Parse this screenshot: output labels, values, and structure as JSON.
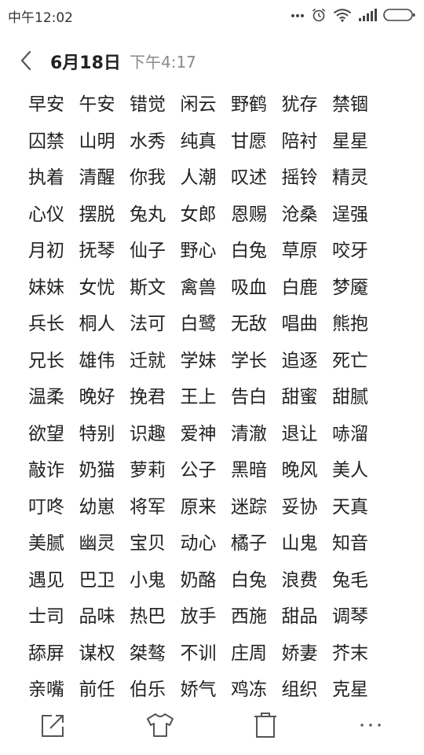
{
  "status_bar": {
    "time": "中午12:02",
    "icons": [
      "more-dots-icon",
      "alarm-clock-icon",
      "wifi-icon",
      "signal-bars-icon",
      "battery-icon"
    ]
  },
  "header": {
    "back_icon": "chevron-left-icon",
    "date": "6月18日",
    "time": "下午4:17"
  },
  "note": {
    "rows": [
      [
        "早安",
        "午安",
        "错觉",
        "闲云",
        "野鹤",
        "犹存",
        "禁锢"
      ],
      [
        "囚禁",
        "山明",
        "水秀",
        "纯真",
        "甘愿",
        "陪衬",
        "星星"
      ],
      [
        "执着",
        "清醒",
        "你我",
        "人潮",
        "叹述",
        "摇铃",
        "精灵"
      ],
      [
        "心仪",
        "摆脱",
        "兔丸",
        "女郎",
        "恩赐",
        "沧桑",
        "逞强"
      ],
      [
        "月初",
        "抚琴",
        "仙子",
        "野心",
        "白兔",
        "草原",
        "咬牙"
      ],
      [
        "妹妹",
        "女忧",
        "斯文",
        "禽兽",
        "吸血",
        "白鹿",
        "梦魇"
      ],
      [
        "兵长",
        "桐人",
        "法可",
        "白鹭",
        "无敌",
        "唱曲",
        "熊抱"
      ],
      [
        "兄长",
        "雄伟",
        "迁就",
        "学妹",
        "学长",
        "追逐",
        "死亡"
      ],
      [
        "温柔",
        "晚好",
        "挽君",
        "王上",
        "告白",
        "甜蜜",
        "甜腻"
      ],
      [
        "欲望",
        "特别",
        "识趣",
        "爱神",
        "清澈",
        "退让",
        "哧溜"
      ],
      [
        "敲诈",
        "奶猫",
        "萝莉",
        "公子",
        "黑暗",
        "晚风",
        "美人"
      ],
      [
        "叮咚",
        "幼崽",
        "将军",
        "原来",
        "迷踪",
        "妥协",
        "天真"
      ],
      [
        "美腻",
        "幽灵",
        "宝贝",
        "动心",
        "橘子",
        "山鬼",
        "知音"
      ],
      [
        "遇见",
        "巴卫",
        "小鬼",
        "奶酪",
        "白兔",
        "浪费",
        "兔毛"
      ],
      [
        "士司",
        "品味",
        "热巴",
        "放手",
        "西施",
        "甜品",
        "调琴"
      ],
      [
        "舔屏",
        "谋权",
        "桀骜",
        "不训",
        "庄周",
        "娇妻",
        "芥末"
      ],
      [
        "亲嘴",
        "前任",
        "伯乐",
        "娇气",
        "鸡冻",
        "组织",
        "克星"
      ]
    ]
  },
  "toolbar": {
    "items": [
      {
        "icon": "share-export-icon"
      },
      {
        "icon": "theme-shirt-icon"
      },
      {
        "icon": "delete-trash-icon"
      },
      {
        "icon": "more-options-icon"
      }
    ]
  }
}
